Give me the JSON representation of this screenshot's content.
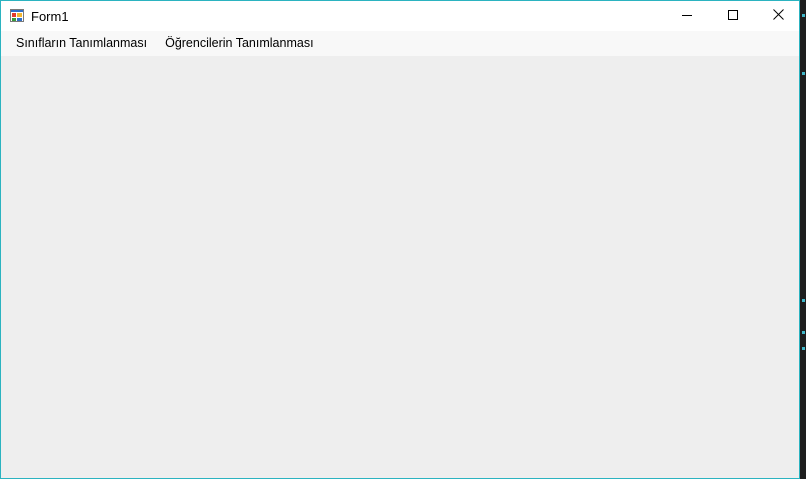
{
  "window": {
    "title": "Form1",
    "accent_color": "#2bb3c0",
    "icon": "winforms-app-icon"
  },
  "caption_buttons": {
    "minimize_icon": "minimize-icon",
    "maximize_icon": "maximize-icon",
    "close_icon": "close-icon"
  },
  "menu": {
    "items": [
      {
        "label": "Sınıfların Tanımlanması"
      },
      {
        "label": "Öğrencilerin Tanımlanması"
      }
    ]
  },
  "colors": {
    "titlebar_bg": "#ffffff",
    "menubar_bg": "#f8f8f8",
    "client_bg": "#eeeeee"
  }
}
